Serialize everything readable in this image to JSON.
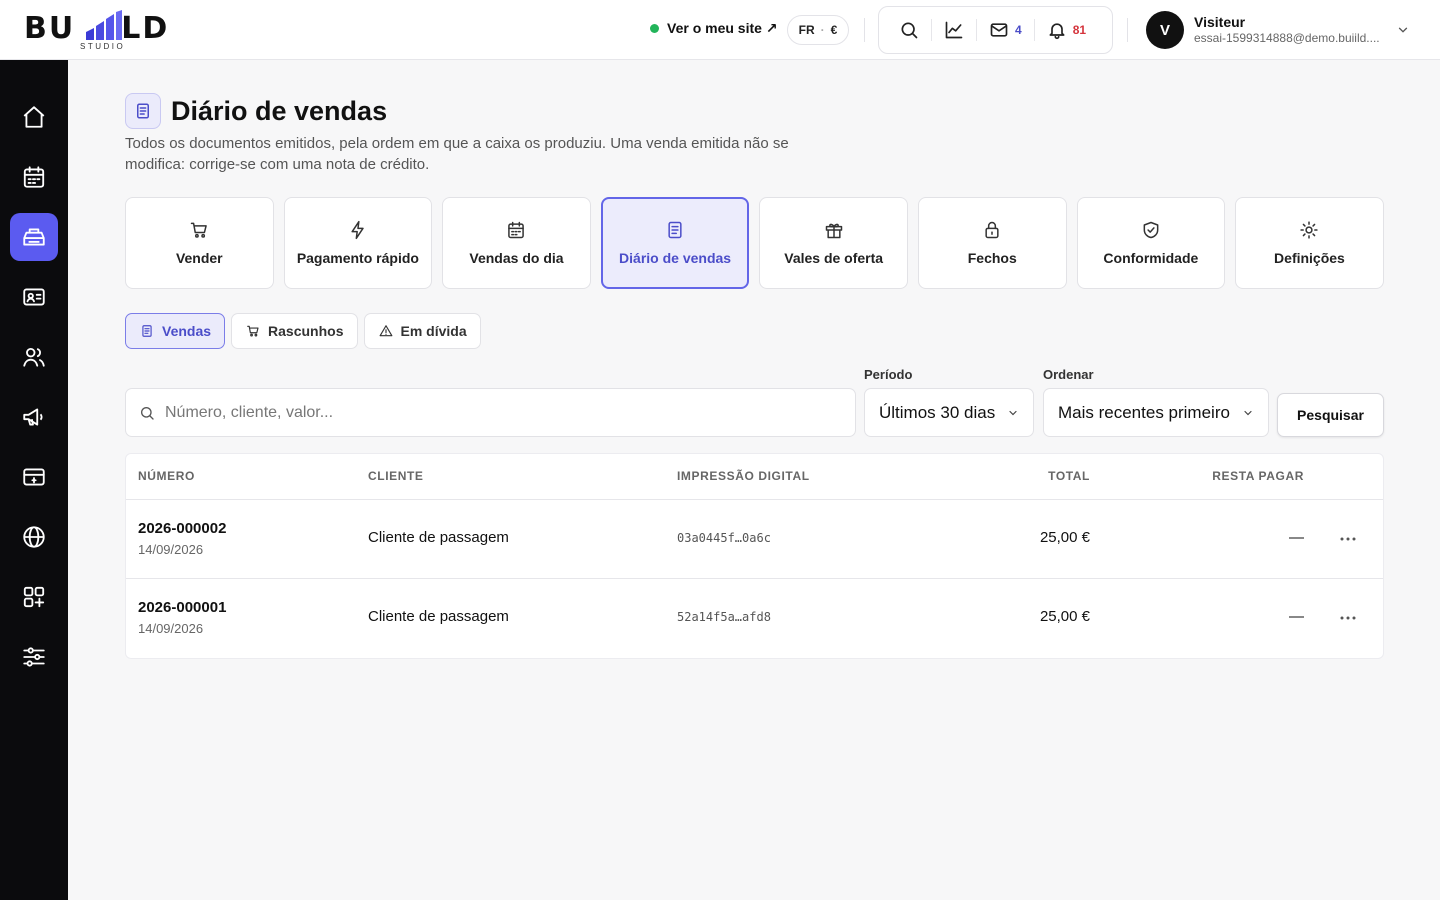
{
  "brand": {
    "logo_text": "BUILD",
    "logo_sub": "STUDIO"
  },
  "topbar": {
    "site_link": "Ver o meu site ↗",
    "lang": "FR",
    "currency": "€",
    "mail_count": "4",
    "notif_count": "81",
    "user_initial": "V",
    "user_name": "Visiteur",
    "user_email": "essai-1599314888@demo.buiild...."
  },
  "icons": {
    "site_status": "status-dot",
    "search": "search-icon",
    "stats": "chart-line-icon",
    "mail": "mail-icon",
    "bell": "bell-icon",
    "user_menu": "chevron-down-icon"
  },
  "colors": {
    "accent": "#5b5bf0",
    "accent_text": "#4b4dc9",
    "status_online": "#22b45a",
    "notif": "#d4343c",
    "sidebar": "#0b0b0d"
  },
  "sidebar": {
    "items": [
      {
        "icon": "home-icon"
      },
      {
        "icon": "calendar-icon"
      },
      {
        "icon": "register-icon",
        "active": true
      },
      {
        "icon": "contact-card-icon"
      },
      {
        "icon": "users-icon"
      },
      {
        "icon": "megaphone-icon"
      },
      {
        "icon": "payment-card-icon"
      },
      {
        "icon": "globe-icon"
      },
      {
        "icon": "apps-icon"
      },
      {
        "icon": "sliders-icon"
      }
    ]
  },
  "page": {
    "title": "Diário de vendas",
    "description": "Todos os documentos emitidos, pela ordem em que a caixa os produziu. Uma venda emitida não se modifica: corrige-se com uma nota de crédito."
  },
  "nav_cards": [
    {
      "label": "Vender",
      "icon": "cart-icon"
    },
    {
      "label": "Pagamento rápido",
      "icon": "bolt-icon"
    },
    {
      "label": "Vendas do dia",
      "icon": "calendar-icon"
    },
    {
      "label": "Diário de vendas",
      "icon": "document-icon",
      "active": true
    },
    {
      "label": "Vales de oferta",
      "icon": "gift-icon"
    },
    {
      "label": "Fechos",
      "icon": "lock-icon"
    },
    {
      "label": "Conformidade",
      "icon": "shield-check-icon"
    },
    {
      "label": "Definições",
      "icon": "settings-icon"
    }
  ],
  "subtabs": [
    {
      "label": "Vendas",
      "icon": "document-icon",
      "active": true
    },
    {
      "label": "Rascunhos",
      "icon": "cart-icon"
    },
    {
      "label": "Em dívida",
      "icon": "warning-icon"
    }
  ],
  "filters": {
    "search_placeholder": "Número, cliente, valor...",
    "search_value": "",
    "period_label": "Período",
    "period_value": "Últimos 30 dias",
    "order_label": "Ordenar",
    "order_value": "Mais recentes primeiro",
    "search_button": "Pesquisar"
  },
  "table": {
    "headers": {
      "number": "NÚMERO",
      "client": "CLIENTE",
      "fingerprint": "IMPRESSÃO DIGITAL",
      "total": "TOTAL",
      "due": "RESTA PAGAR"
    },
    "rows": [
      {
        "number": "2026-000002",
        "date": "14/09/2026",
        "client": "Cliente de passagem",
        "fingerprint": "03a0445f…0a6c",
        "total": "25,00 €",
        "due": "—"
      },
      {
        "number": "2026-000001",
        "date": "14/09/2026",
        "client": "Cliente de passagem",
        "fingerprint": "52a14f5a…afd8",
        "total": "25,00 €",
        "due": "—"
      }
    ]
  }
}
